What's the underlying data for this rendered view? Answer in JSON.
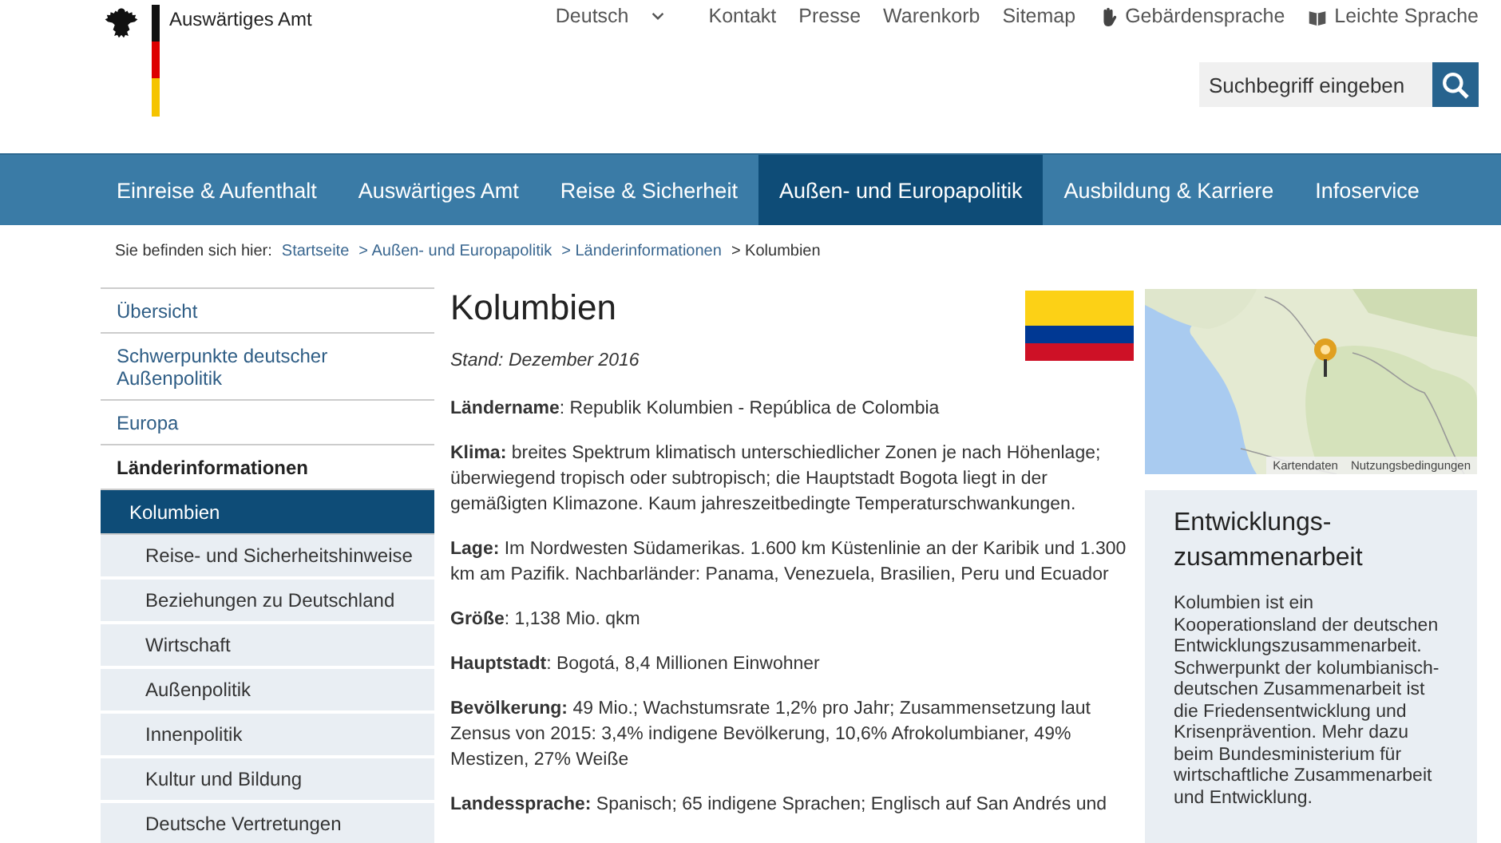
{
  "header": {
    "site_name": "Auswärtiges Amt",
    "language": "Deutsch",
    "links": [
      {
        "label": "Kontakt",
        "kind": "text"
      },
      {
        "label": "Presse",
        "kind": "text"
      },
      {
        "label": "Warenkorb",
        "kind": "text"
      },
      {
        "label": "Sitemap",
        "kind": "text"
      },
      {
        "label": "Gebärdensprache",
        "kind": "hand"
      },
      {
        "label": "Leichte Sprache",
        "kind": "book"
      }
    ],
    "search": {
      "placeholder": "Suchbegriff eingeben"
    }
  },
  "nav": [
    {
      "label": "Einreise & Aufenthalt",
      "selected": false
    },
    {
      "label": "Auswärtiges Amt",
      "selected": false
    },
    {
      "label": "Reise & Sicherheit",
      "selected": false
    },
    {
      "label": "Außen- und Europapolitik",
      "selected": true
    },
    {
      "label": "Ausbildung & Karriere",
      "selected": false
    },
    {
      "label": "Infoservice",
      "selected": false
    }
  ],
  "breadcrumb": {
    "prefix": "Sie befinden sich hier:",
    "items": [
      "Startseite",
      "> Außen- und Europapolitik",
      "> Länderinformationen"
    ],
    "current": "> Kolumbien"
  },
  "sidebar": [
    {
      "label": "Übersicht",
      "selected": false
    },
    {
      "label": "Schwerpunkte deutscher Außenpolitik",
      "selected": false
    },
    {
      "label": "Europa",
      "selected": false
    },
    {
      "label": "Länderinformationen",
      "selected": false,
      "children": [
        {
          "label": "Kolumbien",
          "selected": true,
          "children": [
            {
              "label": "Reise- und Sicherheitshinweise",
              "selected": false
            },
            {
              "label": "Beziehungen zu Deutschland",
              "selected": false
            },
            {
              "label": "Wirtschaft",
              "selected": false
            },
            {
              "label": "Außenpolitik",
              "selected": false
            },
            {
              "label": "Innenpolitik",
              "selected": false
            },
            {
              "label": "Kultur und Bildung",
              "selected": false
            },
            {
              "label": "Deutsche Vertretungen",
              "selected": false
            }
          ]
        }
      ]
    }
  ],
  "article": {
    "title": "Kolumbien",
    "date": "Stand: Dezember 2016",
    "facts": [
      "**Ländername**: Republik Kolumbien - República de Colombia",
      "**Klima:** breites Spektrum klimatisch unterschiedlicher Zonen je nach Höhenlage; überwiegend tropisch oder subtropisch; die Hauptstadt Bogota liegt in der gemäßigten Klimazone. Kaum jahreszeitbedingte Temperaturschwankungen.",
      "**Lage:** Im Nordwesten Südamerikas. 1.600 km Küstenlinie an der Karibik und 1.300 km am Pazifik. Nachbarländer: Panama, Venezuela, Brasilien, Peru und Ecuador",
      "**Größe**: 1,138 Mio. qkm",
      "**Hauptstadt**: Bogotá, 8,4 Millionen Einwohner",
      "**Bevölkerung:** 49 Mio.; Wachstumsrate 1,2% pro Jahr; Zusammensetzung laut Zensus von 2015: 3,4% indigene Bevölkerung, 10,6% Afrokolumbianer, 49% Mestizen, 27% Weiße",
      "**Landessprache:** Spanisch; 65 indigene Sprachen; Englisch auf San Andrés und"
    ]
  },
  "map": {
    "links": [
      "Kartendaten",
      "Nutzungsbedingungen"
    ]
  },
  "teaser": {
    "title": "Entwicklungs-zusammenarbeit",
    "text": "Kolumbien ist ein Kooperationsland der deutschen Entwicklungszusammenarbeit. Schwerpunkt der kolumbianisch-deutschen Zusammenarbeit ist die Friedensentwicklung und Krisenprävention. Mehr dazu beim Bundesministerium für wirtschaftliche Zusammenarbeit und Entwicklung."
  }
}
